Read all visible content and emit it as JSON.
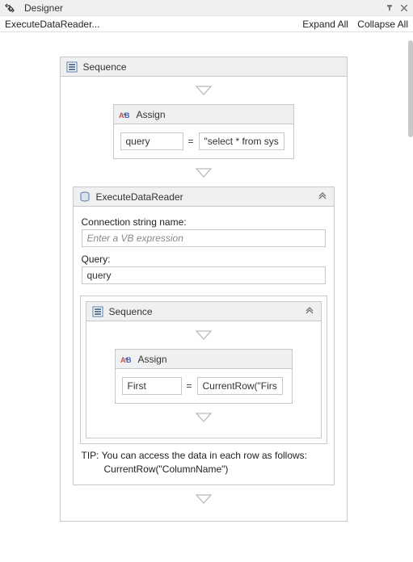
{
  "titlebar": {
    "title": "Designer"
  },
  "toolbar": {
    "breadcrumb": "ExecuteDataReader...",
    "expand_all": "Expand All",
    "collapse_all": "Collapse All"
  },
  "sequence": {
    "title": "Sequence",
    "assign1": {
      "title": "Assign",
      "left_value": "query",
      "right_value": "\"select * from systı"
    },
    "edr": {
      "title": "ExecuteDataReader",
      "conn_label": "Connection string name:",
      "conn_placeholder": "Enter a VB expression",
      "query_label": "Query:",
      "query_value": "query",
      "inner_sequence": {
        "title": "Sequence",
        "assign2": {
          "title": "Assign",
          "left_value": "First",
          "right_value": "CurrentRow(\"FirstN"
        }
      },
      "tip_line1": "TIP: You can access the data in each row as follows:",
      "tip_line2": "CurrentRow(\"ColumnName\")"
    }
  }
}
